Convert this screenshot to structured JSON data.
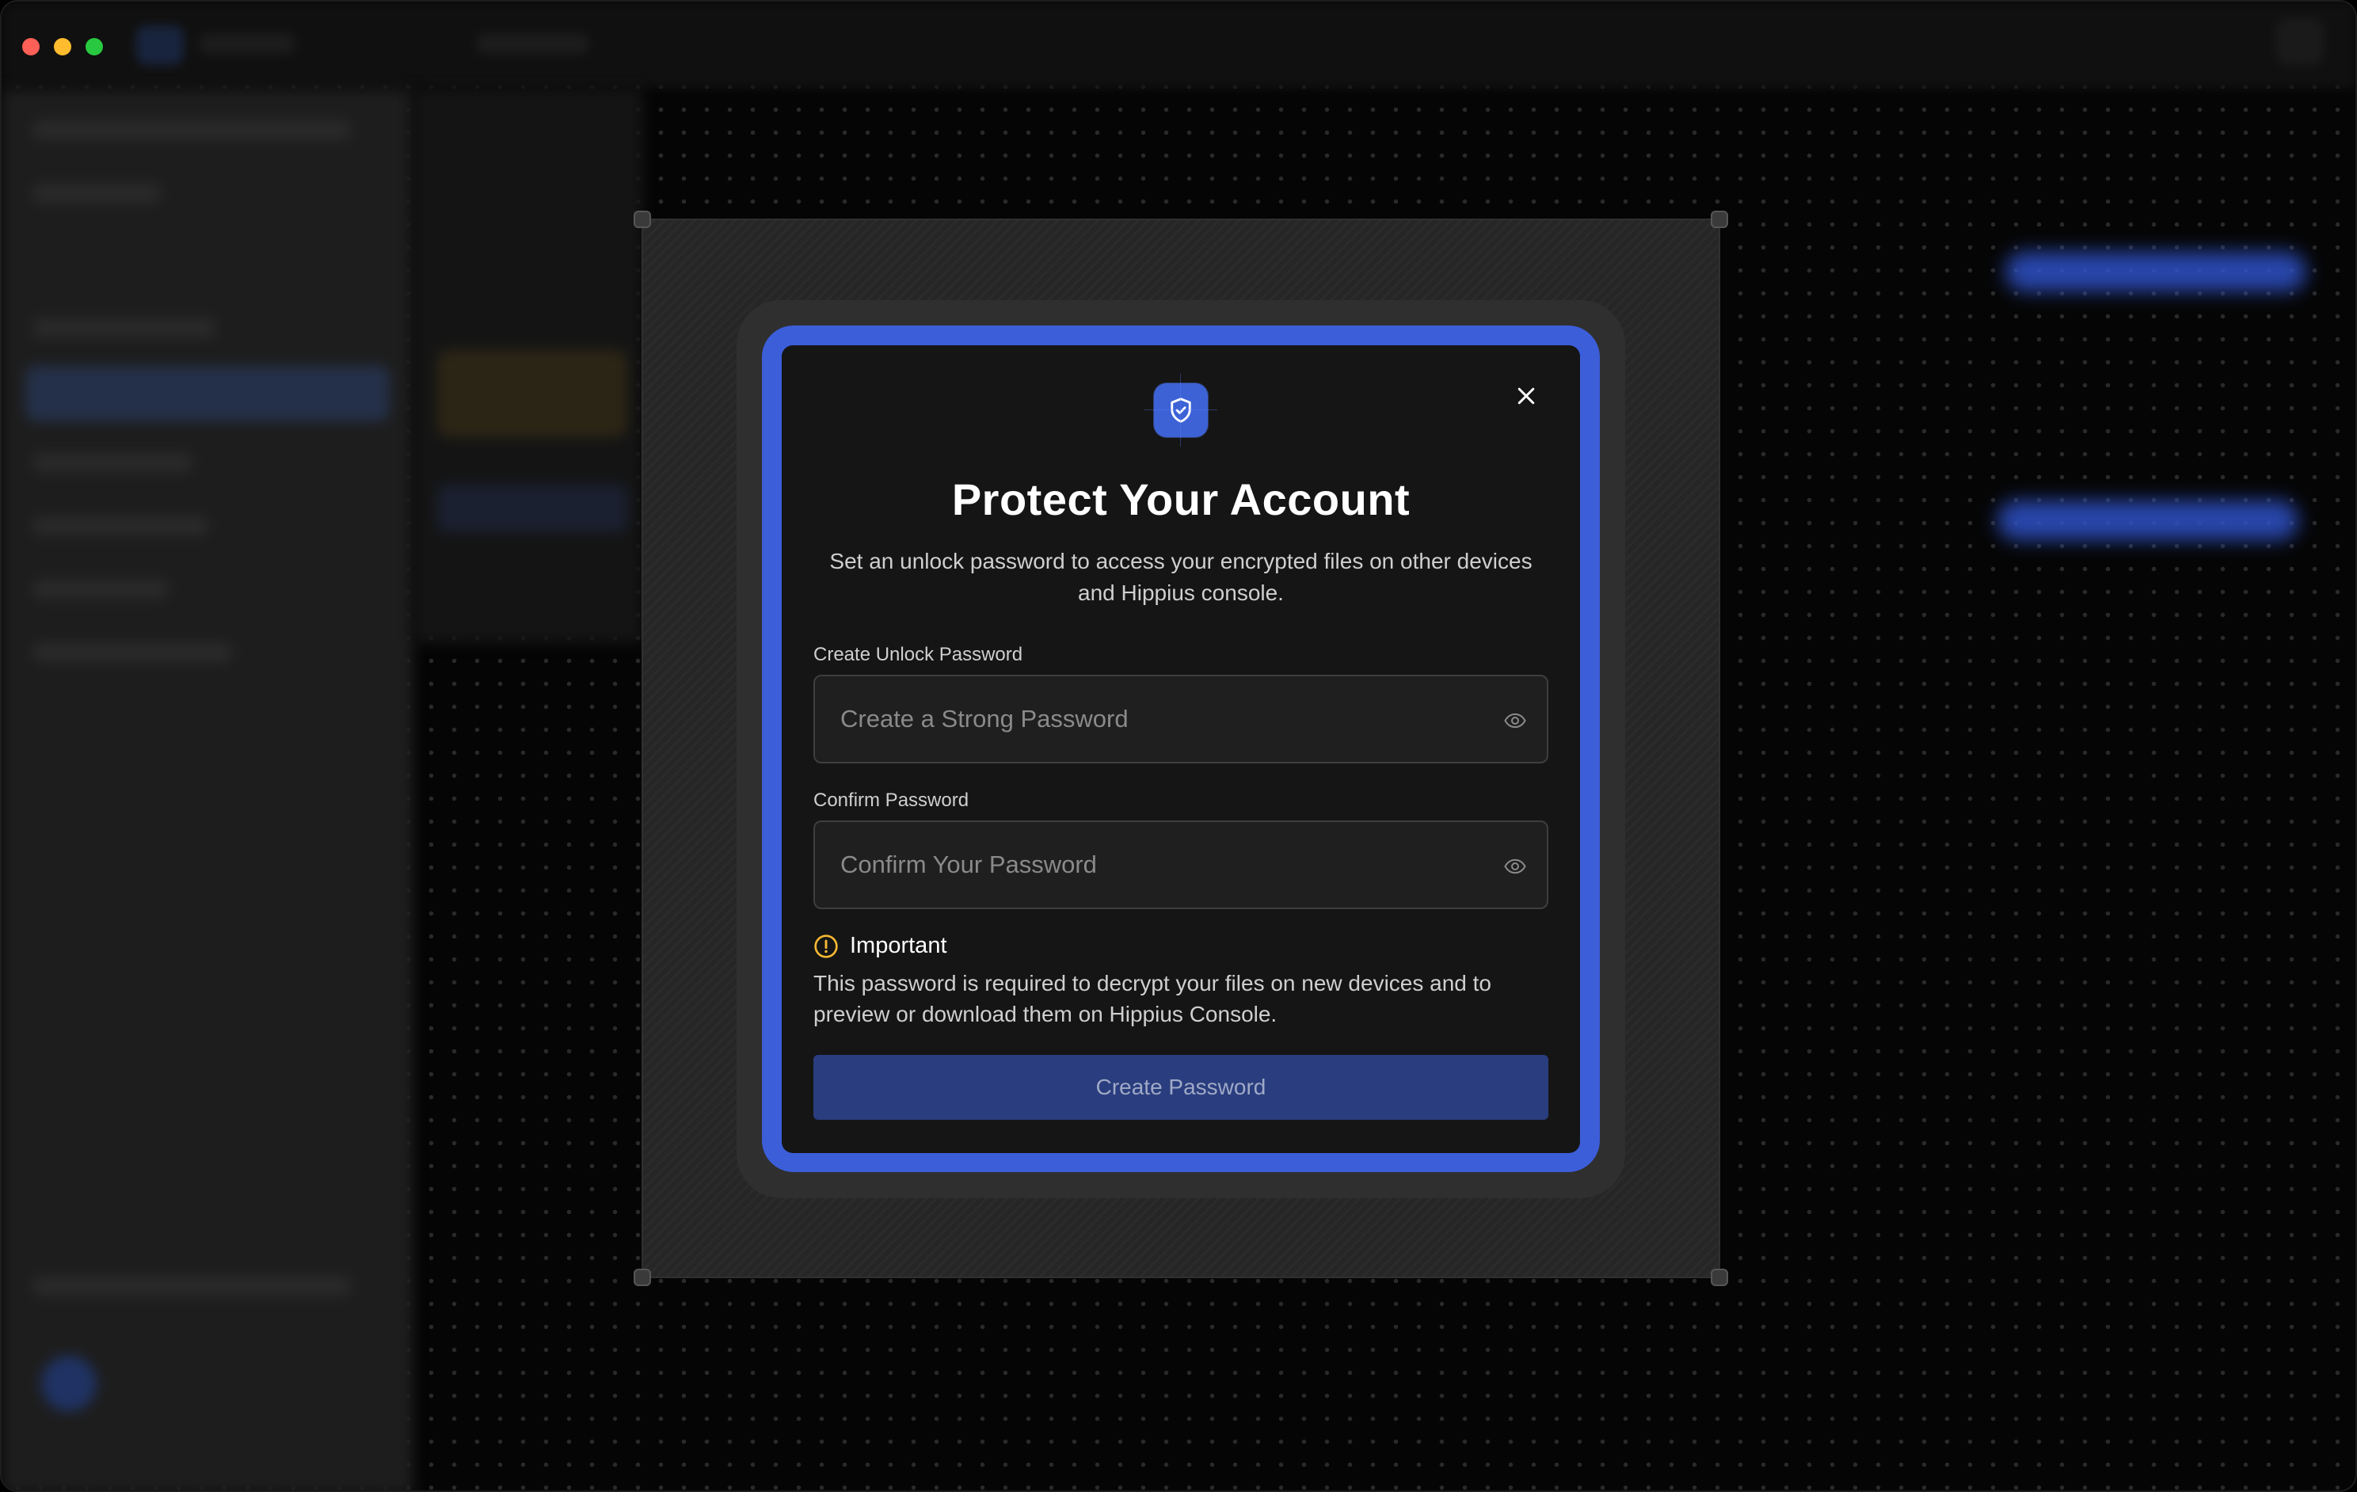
{
  "window": {
    "traffic_lights": [
      "close",
      "minimize",
      "maximize"
    ]
  },
  "modal": {
    "icon": "shield-check-icon",
    "close_icon": "close-icon",
    "title": "Protect Your Account",
    "subtitle": "Set an unlock password to access your encrypted files on other devices and Hippius console.",
    "password_field": {
      "label": "Create Unlock Password",
      "placeholder": "Create a Strong Password",
      "value": "",
      "toggle_icon": "eye-icon"
    },
    "confirm_field": {
      "label": "Confirm Password",
      "placeholder": "Confirm Your Password",
      "value": "",
      "toggle_icon": "eye-icon"
    },
    "notice": {
      "icon": "warning-circle-icon",
      "title": "Important",
      "text": "This password is required to decrypt your files on new devices and to preview or download them on Hippius Console."
    },
    "submit_label": "Create Password"
  },
  "colors": {
    "accent": "#3c5ed9",
    "button_disabled": "#2a3d7e",
    "warning": "#f5b833",
    "modal_bg": "#151515"
  }
}
